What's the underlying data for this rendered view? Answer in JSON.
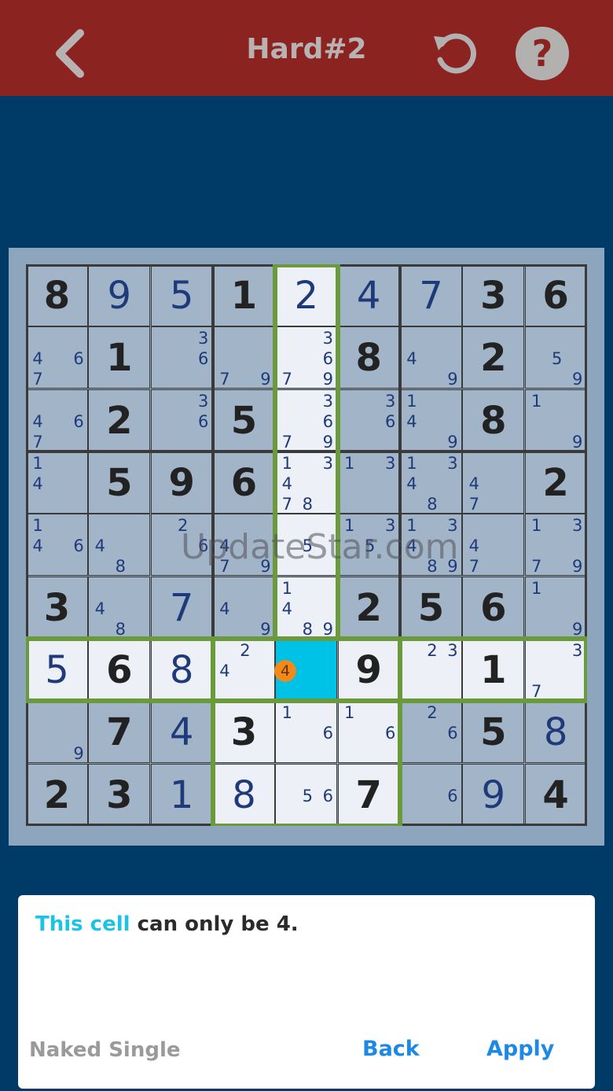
{
  "header": {
    "title": "Hard#2"
  },
  "colors": {
    "header_bg": "#8b2420",
    "page_bg": "#003a66",
    "selected_cell": "#00c2e6",
    "highlight_group": "#6a9a3c",
    "hint_highlight": "#1bc3e6",
    "button": "#1e88e5"
  },
  "icons": {
    "back": "chevron-left-icon",
    "undo": "undo-icon",
    "help": "help-icon"
  },
  "board": {
    "size": 9,
    "cells": [
      [
        "8g",
        "9u",
        "5u",
        "1g",
        "2u",
        "4u",
        "7u",
        "3g",
        "6g"
      ],
      [
        "",
        "1g",
        "",
        "",
        "",
        "8g",
        "",
        "2g",
        ""
      ],
      [
        "",
        "2g",
        "",
        "5g",
        "",
        "",
        "",
        "8g",
        ""
      ],
      [
        "",
        "5g",
        "9g",
        "6g",
        "",
        "",
        "",
        "",
        "2g"
      ],
      [
        "",
        "",
        "",
        "",
        "",
        "",
        "",
        "",
        ""
      ],
      [
        "3g",
        "",
        "7u",
        "",
        "",
        "2g",
        "5g",
        "6g",
        ""
      ],
      [
        "5u",
        "6g",
        "8u",
        "",
        "",
        "9g",
        "",
        "1g",
        ""
      ],
      [
        "",
        "7g",
        "4u",
        "3g",
        "",
        "",
        "",
        "5g",
        "8u"
      ],
      [
        "2g",
        "3g",
        "1u",
        "8u",
        "",
        "7g",
        "",
        "9u",
        "4g"
      ]
    ],
    "candidates": {
      "1_0": [
        4,
        6,
        7
      ],
      "1_2": [
        3,
        6
      ],
      "1_3": [
        7,
        9
      ],
      "1_4": [
        3,
        6,
        7,
        9
      ],
      "1_6": [
        4,
        9
      ],
      "1_8": [
        5,
        9
      ],
      "2_0": [
        4,
        6,
        7
      ],
      "2_2": [
        3,
        6
      ],
      "2_4": [
        3,
        6,
        7,
        9
      ],
      "2_5": [
        3,
        6
      ],
      "2_6": [
        1,
        4,
        9
      ],
      "2_8": [
        1,
        9
      ],
      "3_0": [
        1,
        4
      ],
      "3_4": [
        1,
        3,
        4,
        7,
        8
      ],
      "3_5": [
        1,
        3
      ],
      "3_6": [
        1,
        3,
        4,
        8
      ],
      "3_7": [
        4,
        7
      ],
      "4_0": [
        1,
        4,
        6
      ],
      "4_1": [
        4,
        8
      ],
      "4_2": [
        2,
        6
      ],
      "4_3": [
        4,
        7,
        9
      ],
      "4_4": [
        5
      ],
      "4_5": [
        1,
        3,
        5
      ],
      "4_6": [
        1,
        3,
        4,
        8,
        9
      ],
      "4_7": [
        4,
        7
      ],
      "4_8": [
        1,
        3,
        7,
        9
      ],
      "5_1": [
        4,
        8
      ],
      "5_3": [
        4,
        9
      ],
      "5_4": [
        1,
        4,
        8,
        9
      ],
      "5_8": [
        1,
        9
      ],
      "6_3": [
        2,
        4
      ],
      "6_6": [
        2,
        3
      ],
      "6_8": [
        3,
        7
      ],
      "7_0": [
        9
      ],
      "7_4": [
        1,
        6
      ],
      "7_5": [
        1,
        6
      ],
      "7_6": [
        2,
        6
      ],
      "8_4": [
        5,
        6
      ],
      "8_6": [
        6
      ]
    },
    "selected": {
      "row": 6,
      "col": 4,
      "badge": "4"
    },
    "watermark": "UpdateStar.com"
  },
  "hint": {
    "highlight": "This cell",
    "rest": " can only be 4.",
    "technique": "Naked Single",
    "back_label": "Back",
    "apply_label": "Apply"
  }
}
